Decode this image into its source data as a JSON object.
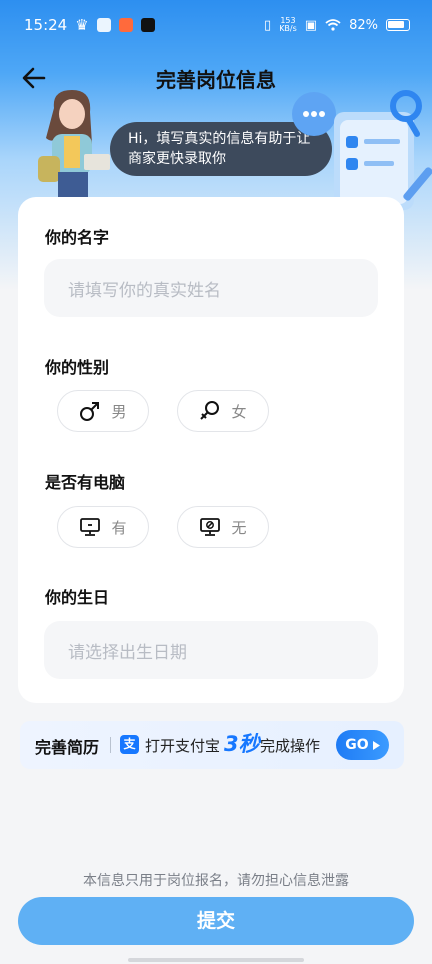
{
  "status_bar": {
    "time": "15:24",
    "net_speed_value": "153",
    "net_speed_unit": "KB/s",
    "battery": "82%"
  },
  "header": {
    "title": "完善岗位信息"
  },
  "assistant": {
    "bubble_text": "Hi，填写真实的信息有助于让商家更快录取你"
  },
  "form": {
    "name": {
      "label": "你的名字",
      "placeholder": "请填写你的真实姓名"
    },
    "gender": {
      "label": "你的性别",
      "options": [
        "男",
        "女"
      ]
    },
    "computer": {
      "label": "是否有电脑",
      "options": [
        "有",
        "无"
      ]
    },
    "birthday": {
      "label": "你的生日",
      "placeholder": "请选择出生日期"
    }
  },
  "banner": {
    "title": "完善简历",
    "icon_char": "支",
    "text_before": "打开支付宝",
    "highlight": "3秒",
    "text_after": "完成操作",
    "go_label": "GO"
  },
  "footer": {
    "privacy_note": "本信息只用于岗位报名，请勿担心信息泄露",
    "submit_label": "提交"
  }
}
